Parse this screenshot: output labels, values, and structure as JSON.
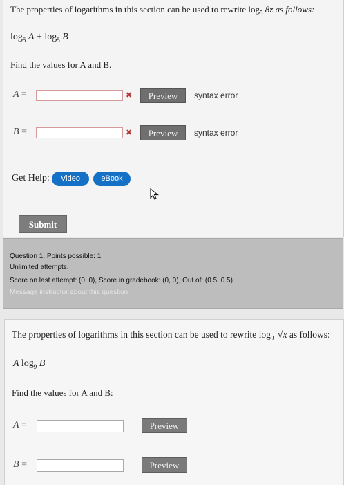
{
  "q1": {
    "prompt_before": "The properties of logarithms in this section can be used to rewrite log",
    "prompt_base": "5",
    "prompt_after": " 8z as follows:",
    "expr_log1": "log",
    "expr_base1": "5",
    "expr_A": "A",
    "expr_plus": " + ",
    "expr_log2": "log",
    "expr_base2": "5",
    "expr_B": "B",
    "find_text": "Find the values for A and B.",
    "rows": [
      {
        "var": "A",
        "eq": "=",
        "value": "",
        "status": "syntax error"
      },
      {
        "var": "B",
        "eq": "=",
        "value": "",
        "status": "syntax error"
      }
    ],
    "preview_label": "Preview",
    "get_help_label": "Get Help:",
    "video_label": "Video",
    "ebook_label": "eBook",
    "submit_label": "Submit"
  },
  "info": {
    "question": "Question 1. Points possible: 1",
    "attempts": "Unlimited attempts.",
    "score": "Score on last attempt: (0, 0), Score in gradebook: (0, 0), Out of: (0.5, 0.5)",
    "message_link": "Message instructor about this question"
  },
  "q2": {
    "prompt_before": "The properties of logarithms in this section can be used to rewrite log",
    "prompt_base": "9",
    "prompt_radicand": "x",
    "prompt_after": " as follows:",
    "expr_A": "A",
    "expr_log": "log",
    "expr_base": "9",
    "expr_B": "B",
    "find_text": "Find the values for A and B:",
    "rows": [
      {
        "var": "A",
        "eq": "=",
        "value": ""
      },
      {
        "var": "B",
        "eq": "=",
        "value": ""
      }
    ],
    "preview_label": "Preview"
  },
  "colors": {
    "pill_blue": "#1571c6",
    "error_red": "#b13838",
    "info_gray": "#bdbdbd"
  },
  "icons": {
    "error": "x-mark-icon",
    "cursor": "mouse-pointer-icon",
    "radical": "square-root-icon"
  }
}
